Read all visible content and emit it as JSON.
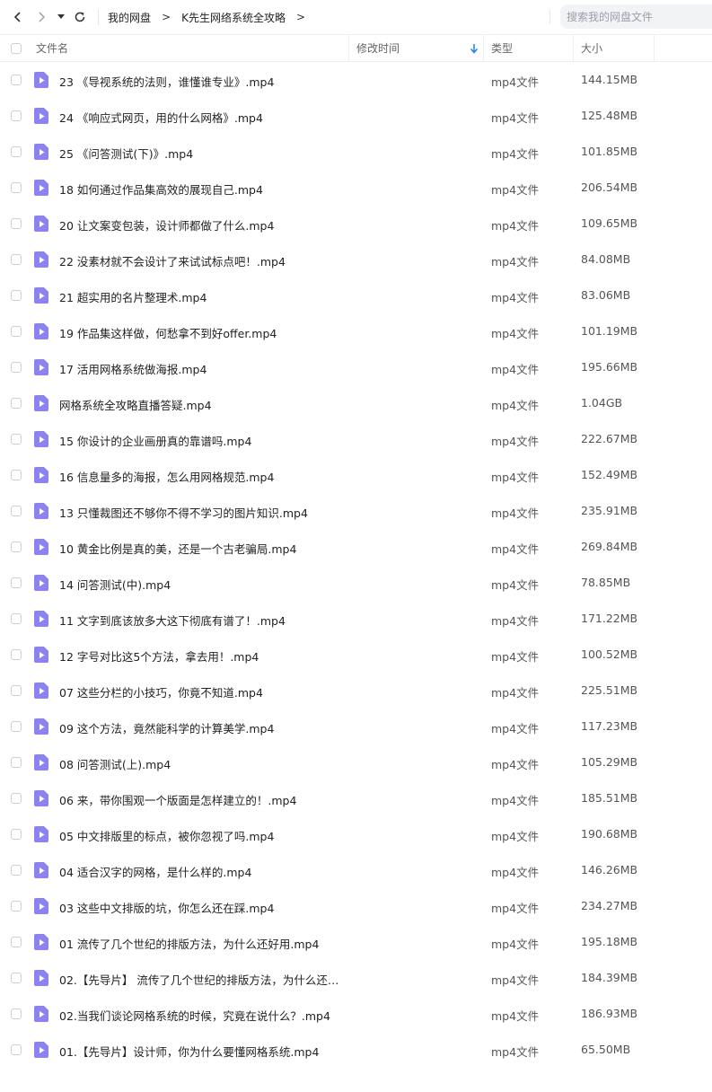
{
  "search": {
    "placeholder": "搜索我的网盘文件"
  },
  "breadcrumb": [
    {
      "label": "我的网盘"
    },
    {
      "label": "K先生网络系统全攻略"
    }
  ],
  "crumb_separator": ">",
  "columns": {
    "name": "文件名",
    "mtime": "修改时间",
    "type": "类型",
    "size": "大小"
  },
  "colors": {
    "accent": "#1e7ff0",
    "file_icon": "#8c83f0"
  },
  "files": [
    {
      "name": "23 《导视系统的法则，谁懂谁专业》.mp4",
      "type": "mp4文件",
      "size": "144.15MB"
    },
    {
      "name": "24 《响应式网页，用的什么网格》.mp4",
      "type": "mp4文件",
      "size": "125.48MB"
    },
    {
      "name": "25 《问答测试(下)》.mp4",
      "type": "mp4文件",
      "size": "101.85MB"
    },
    {
      "name": "18 如何通过作品集高效的展现自己.mp4",
      "type": "mp4文件",
      "size": "206.54MB"
    },
    {
      "name": "20 让文案变包装，设计师都做了什么.mp4",
      "type": "mp4文件",
      "size": "109.65MB"
    },
    {
      "name": "22 没素材就不会设计了来试试标点吧！.mp4",
      "type": "mp4文件",
      "size": "84.08MB"
    },
    {
      "name": "21 超实用的名片整理术.mp4",
      "type": "mp4文件",
      "size": "83.06MB"
    },
    {
      "name": "19 作品集这样做，何愁拿不到好offer.mp4",
      "type": "mp4文件",
      "size": "101.19MB"
    },
    {
      "name": "17 活用网格系统做海报.mp4",
      "type": "mp4文件",
      "size": "195.66MB"
    },
    {
      "name": "网格系统全攻略直播答疑.mp4",
      "type": "mp4文件",
      "size": "1.04GB"
    },
    {
      "name": "15 你设计的企业画册真的靠谱吗.mp4",
      "type": "mp4文件",
      "size": "222.67MB"
    },
    {
      "name": "16 信息量多的海报，怎么用网格规范.mp4",
      "type": "mp4文件",
      "size": "152.49MB"
    },
    {
      "name": "13 只懂裁图还不够你不得不学习的图片知识.mp4",
      "type": "mp4文件",
      "size": "235.91MB"
    },
    {
      "name": "10 黄金比例是真的美，还是一个古老骗局.mp4",
      "type": "mp4文件",
      "size": "269.84MB"
    },
    {
      "name": "14 问答测试(中).mp4",
      "type": "mp4文件",
      "size": "78.85MB"
    },
    {
      "name": "11 文字到底该放多大这下彻底有谱了！.mp4",
      "type": "mp4文件",
      "size": "171.22MB"
    },
    {
      "name": "12 字号对比这5个方法，拿去用！.mp4",
      "type": "mp4文件",
      "size": "100.52MB"
    },
    {
      "name": "07 这些分栏的小技巧，你竟不知道.mp4",
      "type": "mp4文件",
      "size": "225.51MB"
    },
    {
      "name": "09 这个方法，竟然能科学的计算美学.mp4",
      "type": "mp4文件",
      "size": "117.23MB"
    },
    {
      "name": "08 问答测试(上).mp4",
      "type": "mp4文件",
      "size": "105.29MB"
    },
    {
      "name": "06 来，带你围观一个版面是怎样建立的！.mp4",
      "type": "mp4文件",
      "size": "185.51MB"
    },
    {
      "name": "05 中文排版里的标点，被你忽视了吗.mp4",
      "type": "mp4文件",
      "size": "190.68MB"
    },
    {
      "name": "04 适合汉字的网格，是什么样的.mp4",
      "type": "mp4文件",
      "size": "146.26MB"
    },
    {
      "name": "03 这些中文排版的坑，你怎么还在踩.mp4",
      "type": "mp4文件",
      "size": "234.27MB"
    },
    {
      "name": "01 流传了几个世纪的排版方法，为什么还好用.mp4",
      "type": "mp4文件",
      "size": "195.18MB"
    },
    {
      "name": "02.【先导片】 流传了几个世纪的排版方法，为什么还好...",
      "type": "mp4文件",
      "size": "184.39MB"
    },
    {
      "name": "02.当我们谈论网格系统的时候，究竟在说什么？.mp4",
      "type": "mp4文件",
      "size": "186.93MB"
    },
    {
      "name": "01.【先导片】设计师，你为什么要懂网格系统.mp4",
      "type": "mp4文件",
      "size": "65.50MB"
    }
  ]
}
